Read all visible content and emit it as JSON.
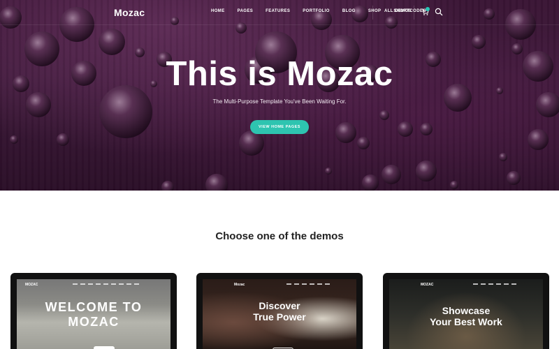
{
  "brand": {
    "logo": "Mozac"
  },
  "nav": {
    "items": [
      "HOME",
      "PAGES",
      "FEATURES",
      "PORTFOLIO",
      "BLOG",
      "SHOP",
      "SHORTCODES"
    ],
    "demos_link": "ALL DEMOS"
  },
  "icons": {
    "cart": "cart-icon",
    "search": "search-icon"
  },
  "hero": {
    "title": "This is Mozac",
    "subtitle": "The Multi-Purpose Template You've Been Waiting For.",
    "button": "VIEW HOME PAGES"
  },
  "section": {
    "title": "Choose one of the demos"
  },
  "demos": [
    {
      "logo": "MOZAC",
      "title_line1": "WELCOME TO",
      "title_line2": "MOZAC"
    },
    {
      "logo": "Mozac",
      "title_line1": "Discover",
      "title_line2": "True Power"
    },
    {
      "logo": "MOZAC",
      "title_line1": "Showcase",
      "title_line2": "Your Best Work"
    }
  ],
  "colors": {
    "accent": "#2ec4b0",
    "hero_bg": "#3a1535",
    "heading": "#222222"
  }
}
